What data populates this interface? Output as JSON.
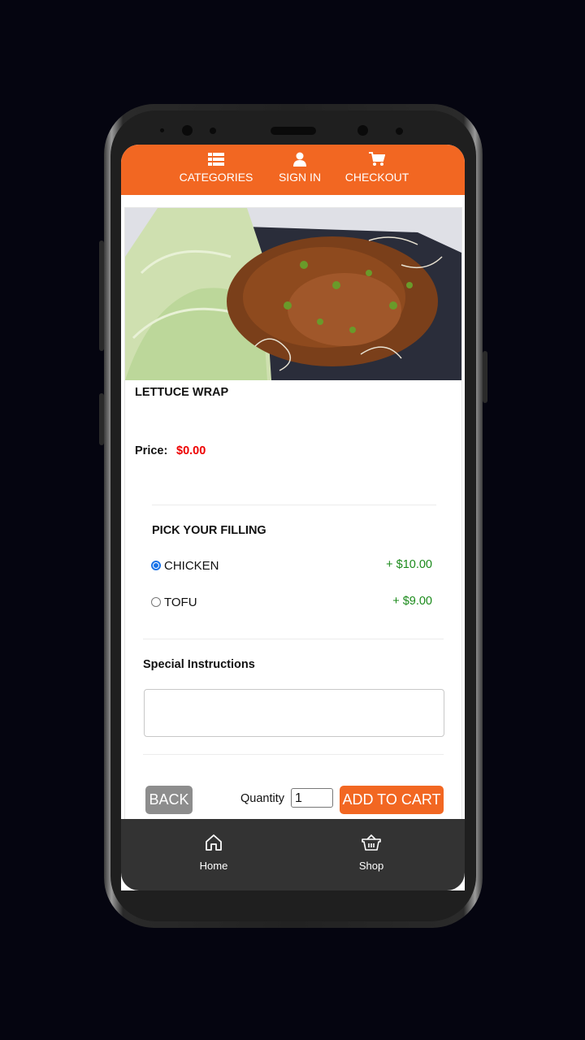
{
  "top_nav": {
    "items": [
      {
        "label": "CATEGORIES",
        "icon": "list-icon"
      },
      {
        "label": "SIGN IN",
        "icon": "user-icon"
      },
      {
        "label": "CHECKOUT",
        "icon": "cart-icon"
      }
    ]
  },
  "product": {
    "image_alt": "lettuce wrap photo",
    "title": "LETTUCE WRAP",
    "price_label": "Price:",
    "price_value": "$0.00"
  },
  "filling": {
    "title": "PICK YOUR FILLING",
    "options": [
      {
        "label": "CHICKEN",
        "price": "+ $10.00",
        "selected": true
      },
      {
        "label": "TOFU",
        "price": "+ $9.00",
        "selected": false
      }
    ]
  },
  "instructions": {
    "title": "Special Instructions",
    "value": "",
    "placeholder": ""
  },
  "actions": {
    "back_label": "BACK",
    "quantity_label": "Quantity",
    "quantity_value": "1",
    "add_to_cart_label": "ADD TO CART"
  },
  "bottom_nav": {
    "items": [
      {
        "label": "Home",
        "icon": "home-icon"
      },
      {
        "label": "Shop",
        "icon": "basket-icon"
      }
    ]
  },
  "colors": {
    "brand_orange": "#f26722",
    "price_red": "#e00000",
    "option_price_green": "#1a8a1a",
    "back_gray": "#8d8d8d",
    "bottom_nav_bg": "#333333"
  }
}
